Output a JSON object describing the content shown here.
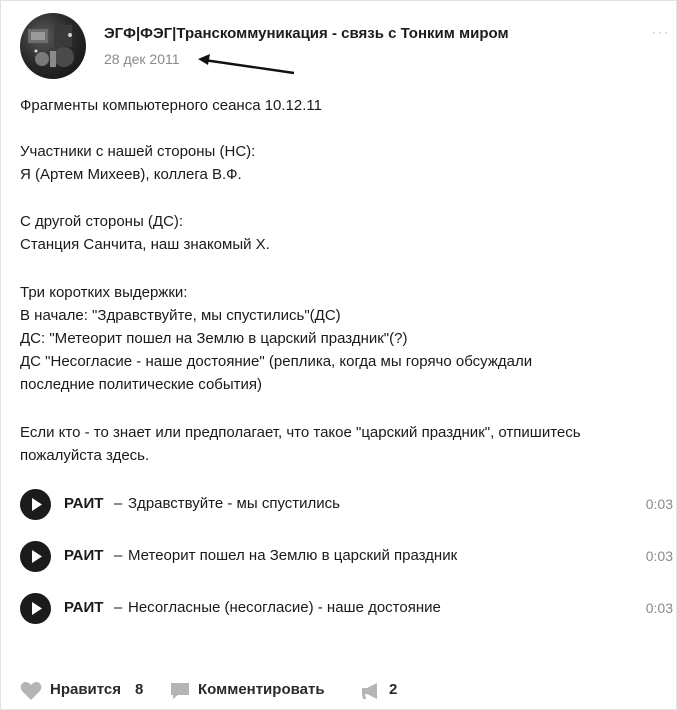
{
  "post": {
    "group_name": "ЭГФ|ФЭГ|Транскоммуникация - связь с Тонким миром",
    "date": "28 дек 2011",
    "more_icon": "more-dots-icon",
    "text_lines": [
      "Фрагменты компьютерного сеанса 10.12.11",
      "Участники с нашей стороны (НС):",
      "Я (Артем Михеев), коллега В.Ф.",
      "С другой стороны (ДС):",
      "Станция Санчита, наш знакомый Х.",
      "Три коротких выдержки:",
      "В начале: \"Здравствуйте, мы спустились\"(ДС)",
      "ДС: \"Метеорит пошел на Землю в царский праздник\"(?)",
      "ДС \"Несогласие - наше достояние\" (реплика, когда мы горячо обсуждали",
      "последние политические события)",
      "Если кто - то знает или предполагает, что такое \"царский праздник\", отпишитесь",
      "пожалуйста здесь."
    ]
  },
  "audio": [
    {
      "artist": "РАИТ",
      "separator": "–",
      "title": "Здравствуйте - мы спустились",
      "duration": "0:03"
    },
    {
      "artist": "РАИТ",
      "separator": "–",
      "title": "Метеорит пошел на Землю в царский праздник",
      "duration": "0:03"
    },
    {
      "artist": "РАИТ",
      "separator": "–",
      "title": "Несогласные (несогласие) - наше достояние",
      "duration": "0:03"
    }
  ],
  "actions": {
    "like_label": "Нравится",
    "like_count": "8",
    "comment_label": "Комментировать",
    "share_count": "2"
  },
  "colors": {
    "text": "#1a1a1a",
    "muted": "#8a8a8a",
    "icon_gray": "#b5b5b5",
    "play_button": "#1b1b1b"
  }
}
